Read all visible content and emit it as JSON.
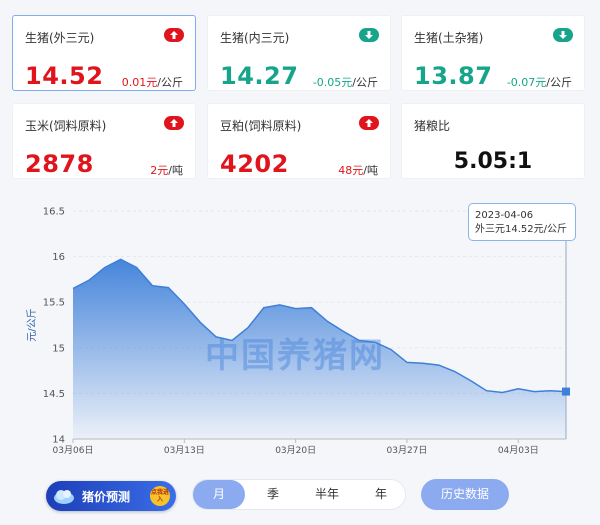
{
  "cards": [
    {
      "name": "生猪(外三元)",
      "price": "14.52",
      "change": "0.01元",
      "unit": "/公斤",
      "direction": "up"
    },
    {
      "name": "生猪(内三元)",
      "price": "14.27",
      "change": "-0.05元",
      "unit": "/公斤",
      "direction": "down"
    },
    {
      "name": "生猪(土杂猪)",
      "price": "13.87",
      "change": "-0.07元",
      "unit": "/公斤",
      "direction": "down"
    },
    {
      "name": "玉米(饲料原料)",
      "price": "2878",
      "change": "2元",
      "unit": "/吨",
      "direction": "up"
    },
    {
      "name": "豆粕(饲料原料)",
      "price": "4202",
      "change": "48元",
      "unit": "/吨",
      "direction": "up"
    }
  ],
  "ratio_card": {
    "name": "猪粮比",
    "value": "5.05:1"
  },
  "colors": {
    "up": "#e0141d",
    "down": "#16a58a",
    "accent": "#8caaf0",
    "line": "#3d7fd9"
  },
  "chart_data": {
    "type": "area",
    "ylabel": "元/公斤",
    "ylim": [
      14,
      16.5
    ],
    "yticks": [
      "14",
      "14.5",
      "15",
      "15.5",
      "16",
      "16.5"
    ],
    "xtick_labels": [
      "03月06日",
      "03月13日",
      "03月20日",
      "03月27日",
      "04月03日"
    ],
    "x": [
      "03-06",
      "03-07",
      "03-08",
      "03-09",
      "03-10",
      "03-11",
      "03-12",
      "03-13",
      "03-14",
      "03-15",
      "03-16",
      "03-17",
      "03-18",
      "03-19",
      "03-20",
      "03-21",
      "03-22",
      "03-23",
      "03-24",
      "03-25",
      "03-26",
      "03-27",
      "03-28",
      "03-29",
      "03-30",
      "03-31",
      "04-01",
      "04-02",
      "04-03",
      "04-04",
      "04-05",
      "04-06"
    ],
    "series": [
      {
        "values": [
          15.65,
          15.74,
          15.88,
          15.97,
          15.88,
          15.68,
          15.66,
          15.48,
          15.28,
          15.12,
          15.08,
          15.22,
          15.44,
          15.47,
          15.43,
          15.44,
          15.29,
          15.18,
          15.08,
          15.06,
          14.98,
          14.84,
          14.83,
          14.81,
          14.74,
          14.64,
          14.53,
          14.51,
          14.55,
          14.52,
          14.53,
          14.52
        ]
      }
    ],
    "grid": true,
    "tooltip": {
      "date": "2023-04-06",
      "label": "外三元14.52元/公斤"
    }
  },
  "watermark": "中国养猪网",
  "predict_button": {
    "label": "猪价预测",
    "badge": "点我进入"
  },
  "period_tabs": [
    "月",
    "季",
    "半年",
    "年"
  ],
  "history_button": "历史数据"
}
